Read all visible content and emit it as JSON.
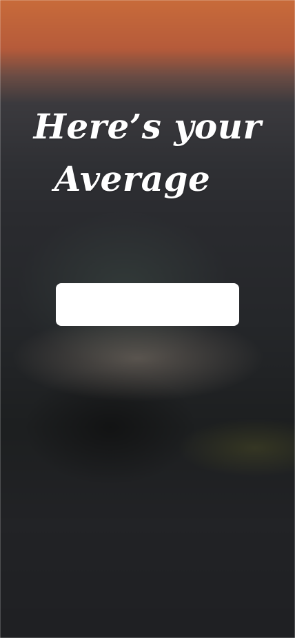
{
  "screen": {
    "title_line1": "Here’s your",
    "title_line2": "Average"
  },
  "average_field": {
    "value": "",
    "placeholder": ""
  }
}
